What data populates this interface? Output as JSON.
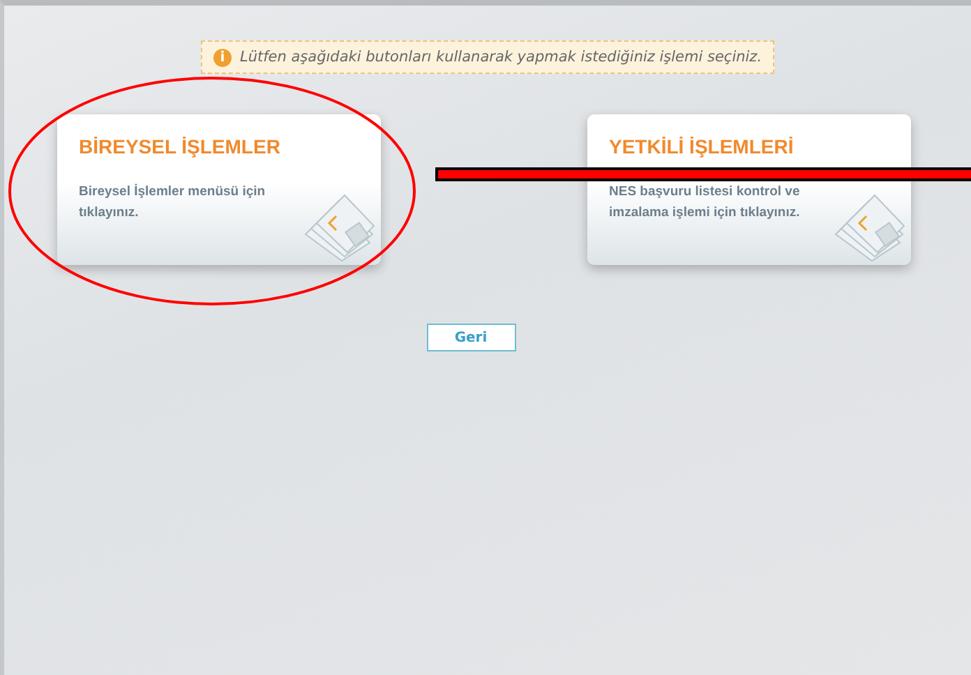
{
  "notice": {
    "icon": "i",
    "text": "Lütfen aşağıdaki butonları kullanarak yapmak istediğiniz işlemi seçiniz."
  },
  "cards": [
    {
      "title": "BİREYSEL İŞLEMLER",
      "description": "Bireysel İşlemler menüsü için tıklayınız."
    },
    {
      "title": "YETKİLİ İŞLEMLERİ",
      "description": "NES başvuru listesi kontrol ve imzalama işlemi için tıklayınız."
    }
  ],
  "back_button": {
    "label": "Geri"
  },
  "annotation_ellipse": {
    "color": "#ff0000"
  },
  "redaction_bar": {
    "color": "#ff0000"
  }
}
